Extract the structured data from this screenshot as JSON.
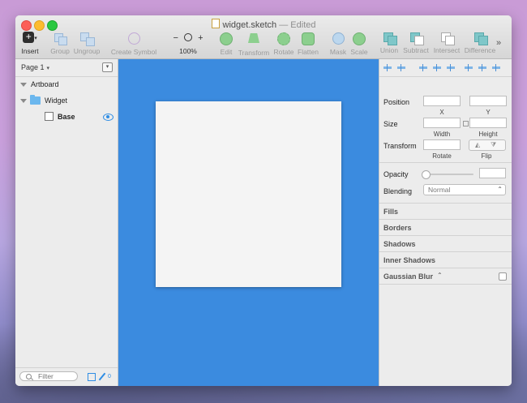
{
  "window": {
    "title": "widget.sketch",
    "status": "— Edited"
  },
  "toolbar": {
    "insert": "Insert",
    "group": "Group",
    "ungroup": "Ungroup",
    "create_symbol": "Create Symbol",
    "zoom_minus": "−",
    "zoom_plus": "+",
    "zoom_level": "100%",
    "edit": "Edit",
    "transform": "Transform",
    "rotate": "Rotate",
    "flatten": "Flatten",
    "mask": "Mask",
    "scale": "Scale",
    "union": "Union",
    "subtract": "Subtract",
    "intersect": "Intersect",
    "difference": "Difference",
    "more": "»"
  },
  "sidebar": {
    "page": "Page 1",
    "layers": [
      {
        "label": "Artboard"
      },
      {
        "label": "Widget"
      },
      {
        "label": "Base"
      }
    ],
    "filter_placeholder": "Filter",
    "pen_count": "0"
  },
  "inspector": {
    "position_label": "Position",
    "x_label": "X",
    "y_label": "Y",
    "size_label": "Size",
    "width_label": "Width",
    "height_label": "Height",
    "transform_label": "Transform",
    "rotate_label": "Rotate",
    "flip_label": "Flip",
    "opacity_label": "Opacity",
    "blending_label": "Blending",
    "blending_value": "Normal",
    "sections": [
      "Fills",
      "Borders",
      "Shadows",
      "Inner Shadows",
      "Gaussian Blur"
    ]
  },
  "colors": {
    "canvas": "#3b8bdf",
    "accent": "#2f8de4"
  }
}
